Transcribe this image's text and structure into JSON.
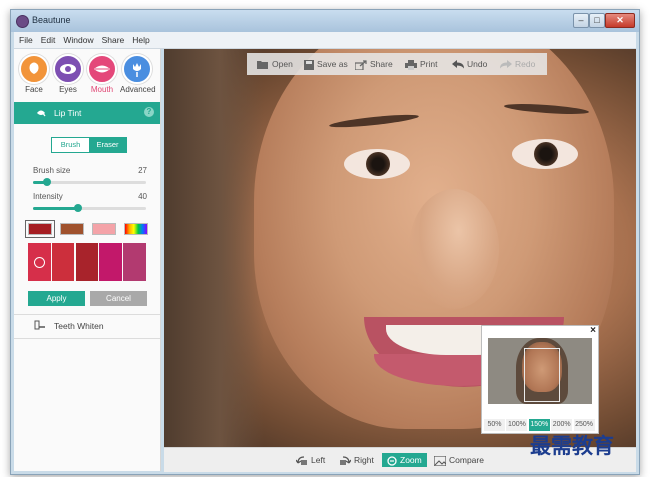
{
  "window": {
    "title": "Beautune"
  },
  "menu": [
    "File",
    "Edit",
    "Window",
    "Share",
    "Help"
  ],
  "categories": [
    {
      "label": "Face",
      "color": "#f2943a"
    },
    {
      "label": "Eyes",
      "color": "#7d4fb2"
    },
    {
      "label": "Mouth",
      "color": "#e4487a",
      "active": true
    },
    {
      "label": "Advanced",
      "color": "#4a8ee0"
    }
  ],
  "lip_tint": {
    "title": "Lip Tint",
    "help": "?"
  },
  "mode": {
    "brush": "Brush",
    "eraser": "Eraser"
  },
  "brush_size": {
    "label": "Brush size",
    "value": "27",
    "fraction": 0.12
  },
  "intensity": {
    "label": "Intensity",
    "value": "40",
    "fraction": 0.4
  },
  "swatches": [
    "#a51e22",
    "#a0522d",
    "#f4a3a8",
    "rainbow"
  ],
  "palette": [
    "#d62f4a",
    "#cc2f3c",
    "#a8232b",
    "#c2186a",
    "#b23a70"
  ],
  "buttons": {
    "apply": "Apply",
    "cancel": "Cancel"
  },
  "teeth_whiten": {
    "label": "Teeth Whiten"
  },
  "toolbar": {
    "open": "Open",
    "save_as": "Save as",
    "share": "Share",
    "print": "Print",
    "undo": "Undo",
    "redo": "Redo"
  },
  "navigator": {
    "close": "×",
    "zooms": [
      "50%",
      "100%",
      "150%",
      "200%",
      "250%"
    ],
    "active_zoom": "150%"
  },
  "bottombar": {
    "left": "Left",
    "right": "Right",
    "zoom": "Zoom",
    "compare": "Compare"
  },
  "watermark": "最需教育",
  "colors": {
    "accent": "#24a891",
    "mouth_active": "#e04573"
  }
}
